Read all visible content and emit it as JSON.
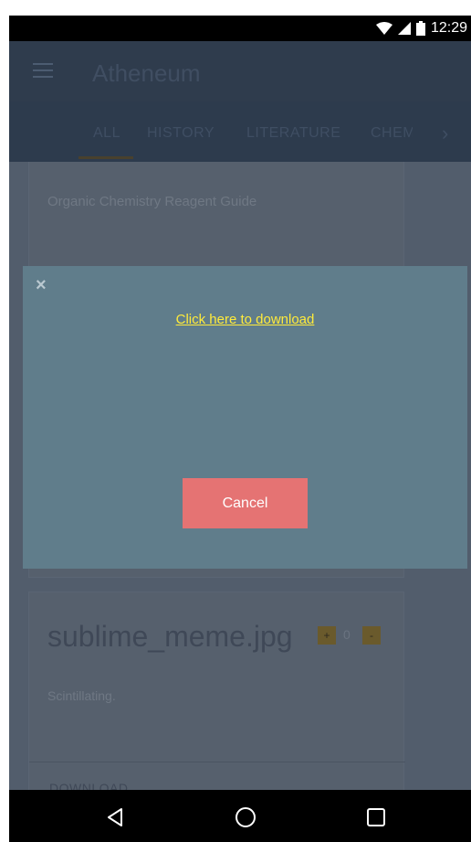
{
  "status_bar": {
    "time": "12:29",
    "icons": [
      "wifi-icon",
      "signal-icon",
      "battery-icon"
    ]
  },
  "app_bar": {
    "menu_icon": "hamburger-menu-icon",
    "title": "Atheneum"
  },
  "tabs": {
    "items": [
      {
        "label": "ALL",
        "selected": true
      },
      {
        "label": "HISTORY",
        "selected": false
      },
      {
        "label": "LITERATURE",
        "selected": false
      },
      {
        "label": "CHEM",
        "selected": false
      }
    ],
    "next_icon": "chevron-right-icon",
    "next_glyph": "›"
  },
  "cards": [
    {
      "title": "Organic Chemistry Reagent Guide"
    },
    {
      "title": "sublime_meme.jpg",
      "upvote_label": "+",
      "vote_count": "0",
      "downvote_label": "-",
      "description": "Scintillating.",
      "action_label": "DOWNLOAD"
    }
  ],
  "dialog": {
    "close_glyph": "×",
    "link_text": "Click here to download",
    "cancel_label": "Cancel"
  },
  "nav_bar": {
    "icons": [
      "back-icon",
      "home-icon",
      "recents-icon"
    ]
  },
  "colors": {
    "dialog_bg": "#607d8b",
    "cancel_bg": "#e57373",
    "link": "#ffeb3b"
  }
}
